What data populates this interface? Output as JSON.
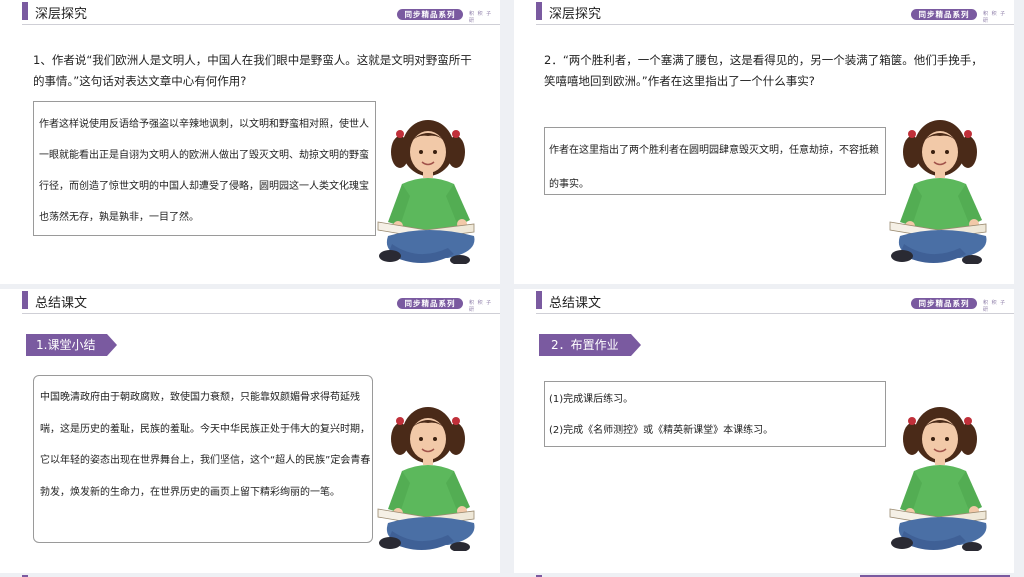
{
  "badge": "同步精品系列",
  "badge_sub": "积 积 子 研",
  "slides": [
    {
      "title": "深层探究",
      "question": "1、作者说“我们欧洲人是文明人，中国人在我们眼中是野蛮人。这就是文明对野蛮所干的事情。”这句话对表达文章中心有何作用?",
      "answer": "作者这样说使用反语给予强盗以辛辣地讽刺，以文明和野蛮相对照，使世人一眼就能看出正是自诩为文明人的欧洲人做出了毁灭文明、劫掠文明的野蛮行径，而创造了惊世文明的中国人却遭受了侵略，圆明园这一人类文化瑰宝也荡然无存，孰是孰非，一目了然。"
    },
    {
      "title": "深层探究",
      "question": "2．“两个胜利者，一个塞满了腰包，这是看得见的，另一个装满了箱箧。他们手挽手，笑嘻嘻地回到欧洲。”作者在这里指出了一个什么事实?",
      "answer": "作者在这里指出了两个胜利者在圆明园肆意毁灭文明，任意劫掠，不容抵赖的事实。"
    },
    {
      "title": "总结课文",
      "tag": "1.课堂小结",
      "answer": "中国晚清政府由于朝政腐败，致使国力衰颓，只能靠奴颜媚骨求得苟延残喘，这是历史的羞耻，民族的羞耻。今天中华民族正处于伟大的复兴时期，它以年轻的姿态出现在世界舞台上，我们坚信，这个“超人的民族”定会青春勃发，焕发新的生命力，在世界历史的画页上留下精彩绚丽的一笔。"
    },
    {
      "title": "总结课文",
      "tag": "2．布置作业",
      "items": [
        "(1)完成课后练习。",
        "(2)完成《名师测控》或《精英新课堂》本课练习。"
      ]
    }
  ],
  "colors": {
    "accent": "#7a5aa0",
    "shirt": "#5cb85c",
    "jeans": "#4a6fa5"
  }
}
